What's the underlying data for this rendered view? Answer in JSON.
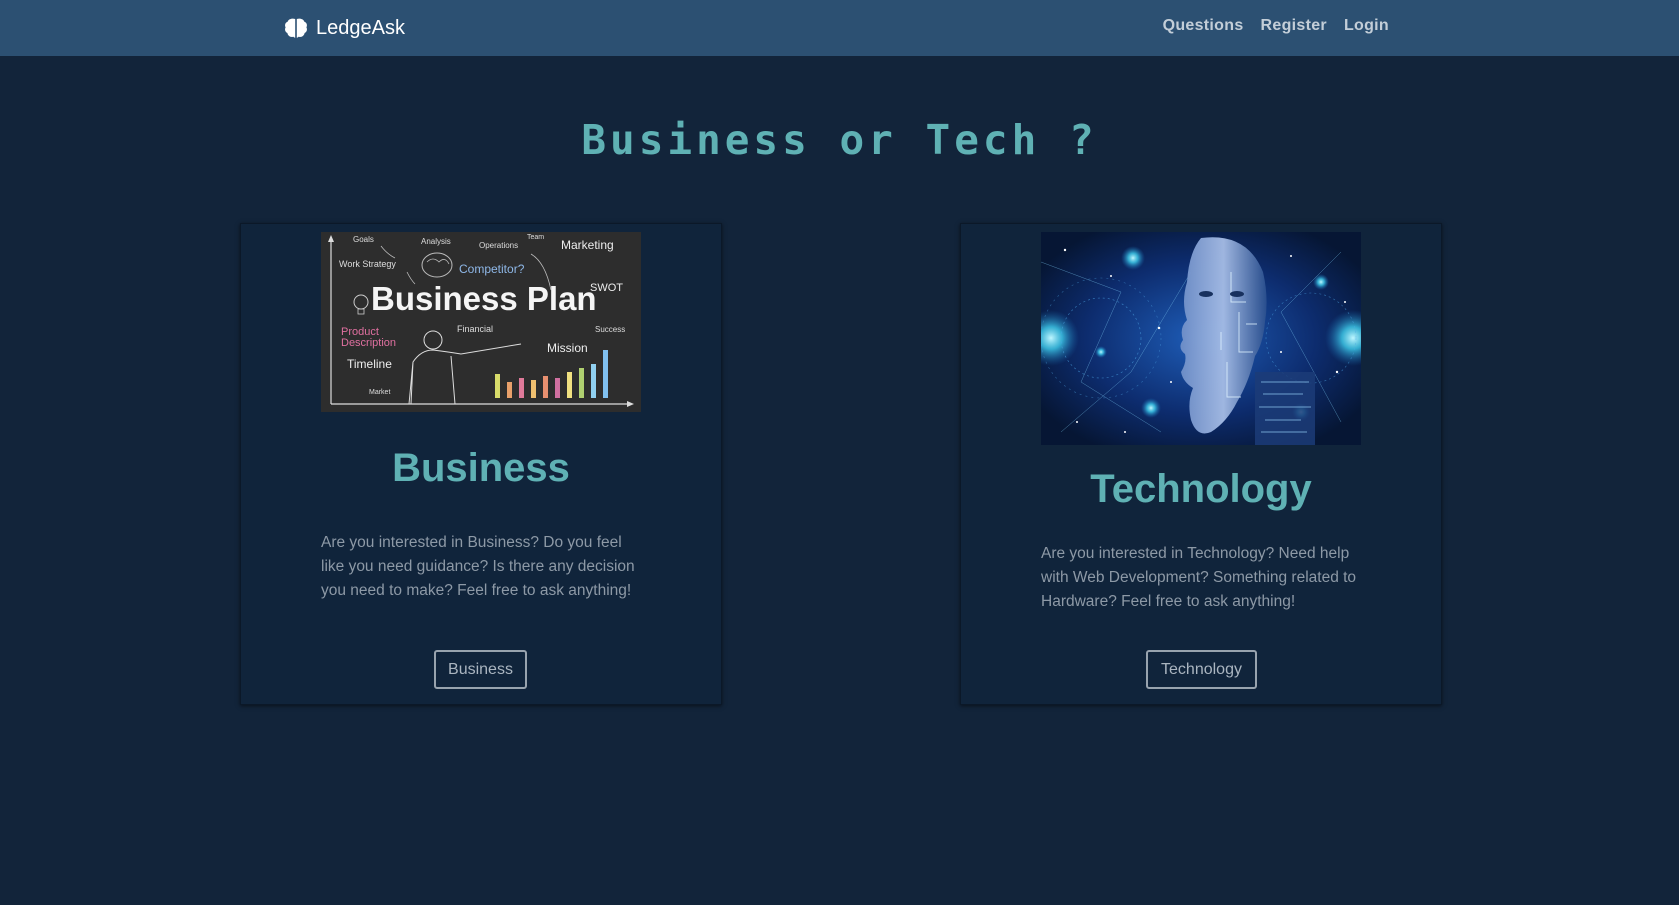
{
  "navbar": {
    "brand": "LedgeAsk",
    "links": [
      "Questions",
      "Register",
      "Login"
    ]
  },
  "hero": {
    "title": "Business or Tech ?"
  },
  "cards": [
    {
      "title": "Business",
      "text": "Are you interested in Business? Do you feel like you need guidance? Is there any decision you need to make? Feel free to ask anything!",
      "button": "Business",
      "image_words": {
        "headline": "Business Plan",
        "labels": [
          "Goals",
          "Analysis",
          "Team",
          "Operations",
          "Marketing",
          "Work Strategy",
          "Competitor?",
          "SWOT",
          "Product",
          "Description",
          "Financial",
          "Success",
          "Mission",
          "Timeline",
          "Market"
        ]
      }
    },
    {
      "title": "Technology",
      "text": "Are you interested in Technology? Need help with Web Development? Something related to Hardware? Feel free to ask anything!",
      "button": "Technology"
    }
  ],
  "colors": {
    "navbar": "#2c5072",
    "background": "#12243a",
    "accent": "#5fb1b4",
    "card": "#10243b"
  },
  "icons": {
    "brand": "brain-icon"
  }
}
